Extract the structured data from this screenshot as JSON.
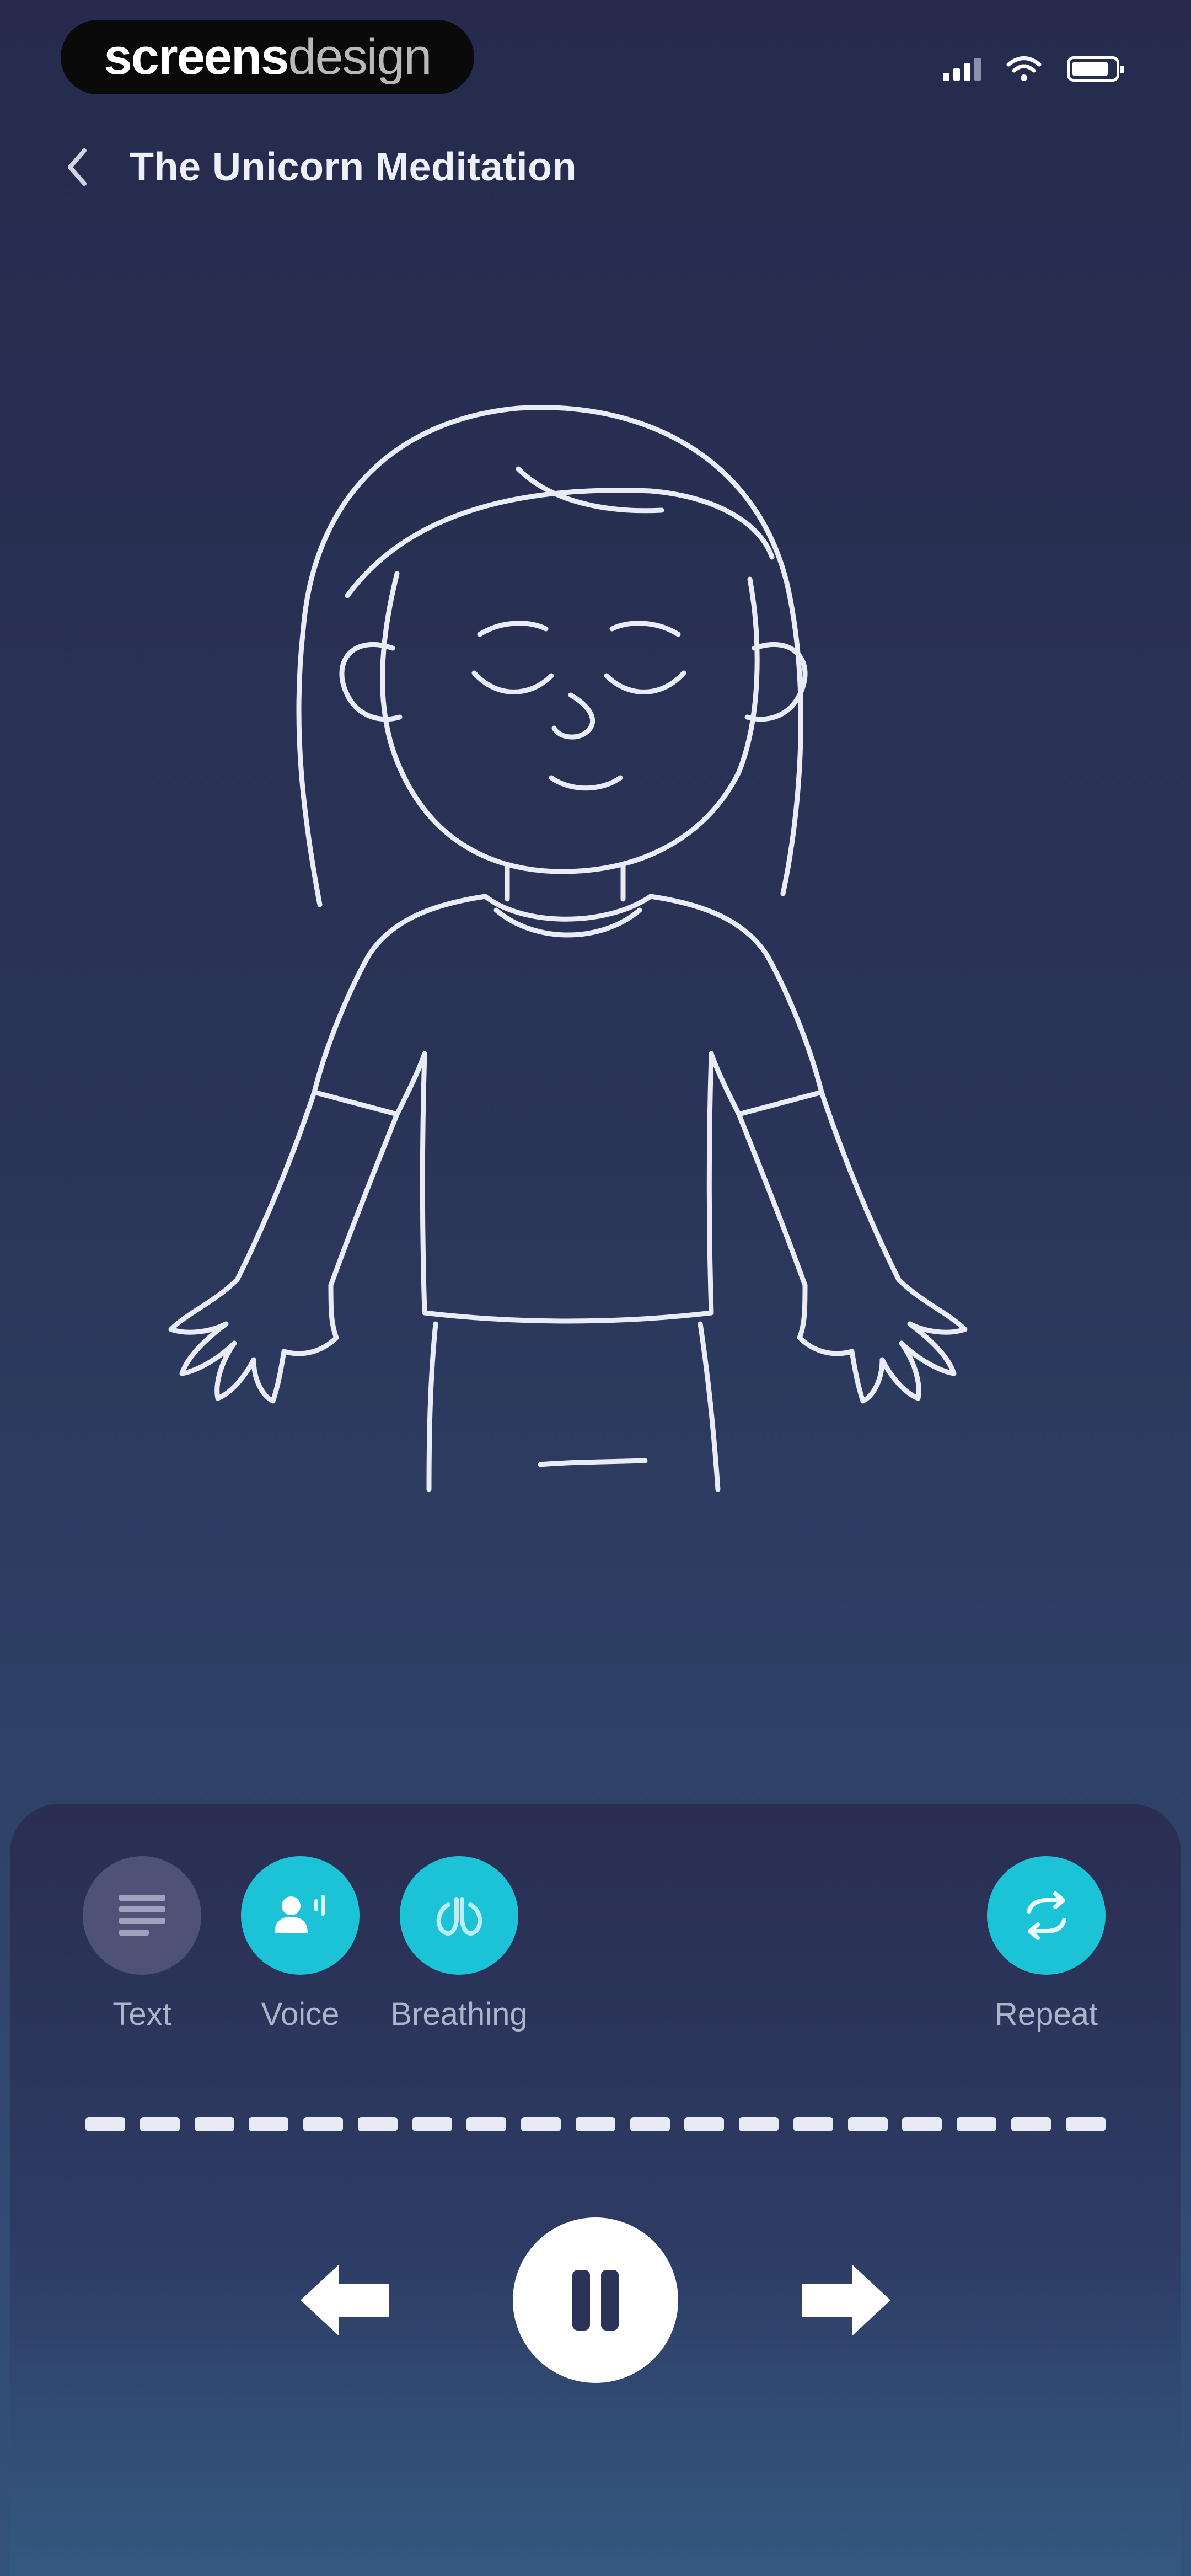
{
  "watermark": {
    "part1": "screens",
    "part2": "design"
  },
  "header": {
    "title": "The Unicorn Meditation"
  },
  "controls": {
    "text_label": "Text",
    "voice_label": "Voice",
    "breathing_label": "Breathing",
    "repeat_label": "Repeat"
  },
  "colors": {
    "accent": "#1cc2d6",
    "inactive": "#4f5277",
    "background_top": "#262b4d",
    "background_bottom": "#33527a"
  },
  "icons": {
    "back": "chevron-left-icon",
    "text": "text-lines-icon",
    "voice": "voice-person-icon",
    "breathing": "breathing-icon",
    "repeat": "repeat-icon",
    "previous": "arrow-left-icon",
    "pause": "pause-icon",
    "next": "arrow-right-icon"
  },
  "progress": {
    "segments": 19
  }
}
